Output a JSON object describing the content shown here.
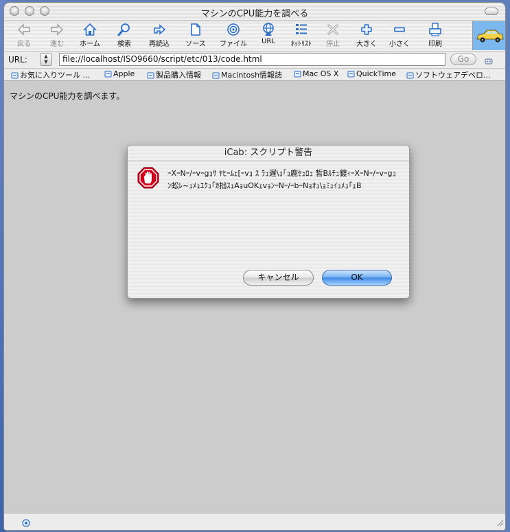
{
  "window": {
    "title": "マシンのCPU能力を調べる"
  },
  "toolbar": {
    "buttons": [
      {
        "label": "戻る",
        "icon": "back-arrow-icon",
        "enabled": false
      },
      {
        "label": "進む",
        "icon": "forward-arrow-icon",
        "enabled": false
      },
      {
        "label": "ホーム",
        "icon": "home-icon",
        "enabled": true
      },
      {
        "label": "検索",
        "icon": "magnifier-icon",
        "enabled": true
      },
      {
        "label": "再読込",
        "icon": "reload-icon",
        "enabled": true
      },
      {
        "label": "ソース",
        "icon": "document-icon",
        "enabled": true
      },
      {
        "label": "ファイル",
        "icon": "target-icon",
        "enabled": true
      },
      {
        "label": "URL",
        "icon": "globe-icon",
        "enabled": true
      },
      {
        "label": "ﾎｯﾄﾘｽﾄ",
        "icon": "hotlist-icon",
        "enabled": true
      },
      {
        "label": "停止",
        "icon": "stop-icon",
        "enabled": false
      },
      {
        "label": "大きく",
        "icon": "plus-icon",
        "enabled": true
      },
      {
        "label": "小さく",
        "icon": "minus-icon",
        "enabled": true
      },
      {
        "label": "印刷",
        "icon": "printer-icon",
        "enabled": true
      }
    ]
  },
  "urlbar": {
    "label": "URL:",
    "value": "file://localhost/ISO9660/script/etc/013/code.html",
    "go_label": "Go"
  },
  "bookmarks": [
    "お気に入りツール ...",
    "Apple",
    "製品購入情報",
    "Macintosh情報誌",
    "Mac OS X",
    "QuickTime",
    "ソフトウェアデベロ..."
  ],
  "page": {
    "text": "マシンのCPU能力を調べます。"
  },
  "dialog": {
    "title": "iCab: スクリプト警告",
    "message": "ｰXｰNｰ/ｰvｰgｮｻ  ﾔﾋｰﾑｪ[ｰvｮ ｽ ﾗｭ遅\\ｮ｢ｮ鹿ｾｭﾛｭ  皙Bﾙﾁｭ鍍ｨｰXｰNｰ/ｰvｰgｮﾝ蚣ﾚ~ｭﾒｭﾕｸｭ｢ｶ拙ｽｪAｮuOKｪvｮﾝｰNｰ/ｰbｰNｮｵｭ\\ｮﾐｭｲｭﾒｭ｢ｪB",
    "cancel_label": "キャンセル",
    "ok_label": "OK"
  },
  "colors": {
    "accent": "#3f8ae6",
    "stop": "#d0021b"
  }
}
